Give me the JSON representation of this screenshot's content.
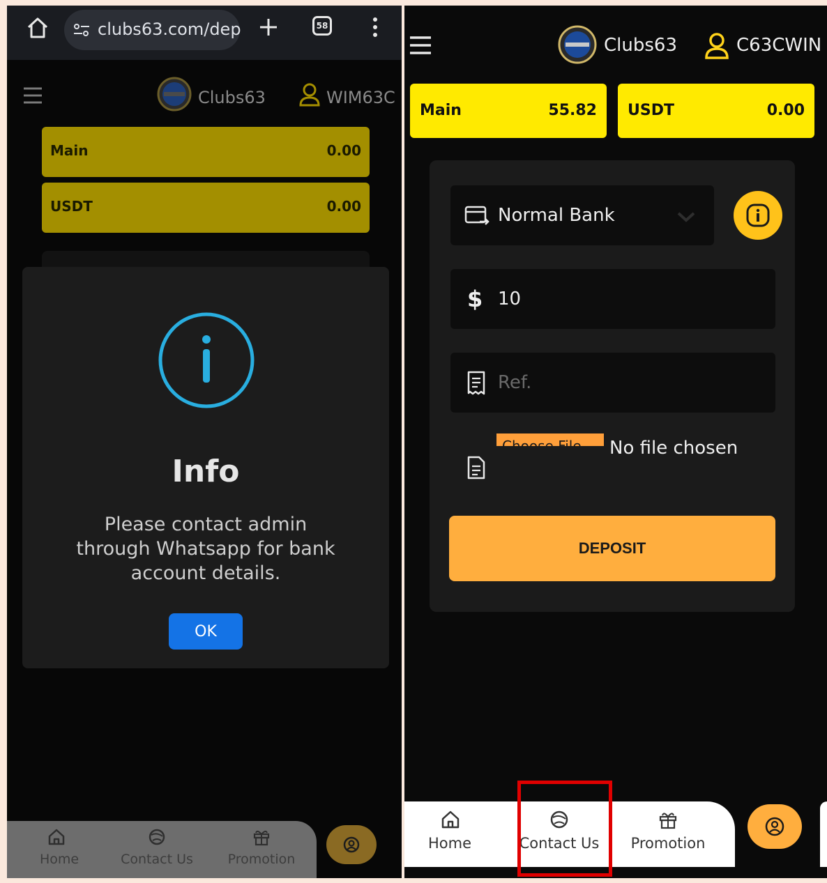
{
  "left": {
    "browser": {
      "url": "clubs63.com/dep",
      "tab_count": "58"
    },
    "header": {
      "brand": "Clubs63",
      "username": "WIM63C"
    },
    "balances": [
      {
        "label": "Main",
        "value": "0.00"
      },
      {
        "label": "USDT",
        "value": "0.00"
      }
    ],
    "dialog": {
      "title": "Info",
      "message": "Please contact admin through Whatsapp for bank account details.",
      "ok_label": "OK"
    },
    "nav": {
      "home": "Home",
      "contact": "Contact Us",
      "promotion": "Promotion"
    }
  },
  "right": {
    "header": {
      "brand": "Clubs63",
      "username": "C63CWIN"
    },
    "balances": [
      {
        "label": "Main",
        "value": "55.82"
      },
      {
        "label": "USDT",
        "value": "0.00"
      }
    ],
    "form": {
      "method": "Normal Bank",
      "currency_symbol": "$",
      "amount": "10",
      "ref_placeholder": "Ref.",
      "file_button": "Choose File",
      "file_status": "No file chosen",
      "deposit_label": "DEPOSIT"
    },
    "nav": {
      "home": "Home",
      "contact": "Contact Us",
      "promotion": "Promotion"
    }
  },
  "colors": {
    "accent_yellow": "#ffea00",
    "accent_orange": "#ffae3e",
    "info_blue": "#29aee0",
    "ok_blue": "#1473e6",
    "highlight_red": "#e00000"
  }
}
